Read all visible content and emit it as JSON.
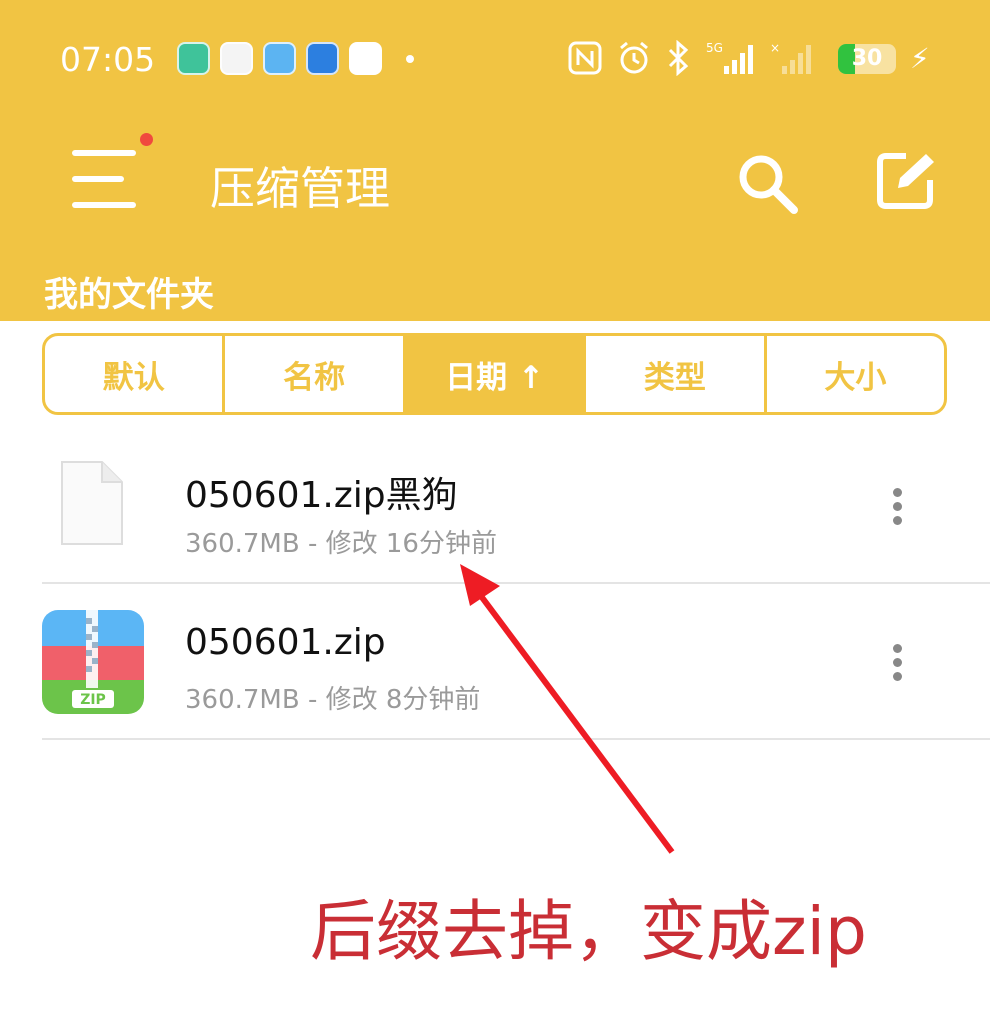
{
  "status_bar": {
    "time": "07:05",
    "battery": "30",
    "battery_level": 0.3,
    "icons": [
      "nfc-icon",
      "alarm-icon",
      "bluetooth-icon",
      "signal-5g-icon",
      "signal-icon",
      "battery-icon",
      "charging-icon"
    ]
  },
  "toolbar": {
    "title": "压缩管理",
    "has_notification": true
  },
  "folder": {
    "title": "我的文件夹"
  },
  "sort_tabs": [
    {
      "label": "默认",
      "active": false
    },
    {
      "label": "名称",
      "active": false
    },
    {
      "label": "日期 ↑",
      "active": true
    },
    {
      "label": "类型",
      "active": false
    },
    {
      "label": "大小",
      "active": false
    }
  ],
  "files": [
    {
      "name": "050601.zip黑狗",
      "meta": "360.7MB - 修改 16分钟前",
      "icon": "blank-file-icon"
    },
    {
      "name": "050601.zip",
      "meta": "360.7MB - 修改 8分钟前",
      "icon": "zip-file-icon"
    }
  ],
  "annotation": {
    "text": "后缀去掉，变成zip",
    "color": "#C92E35"
  },
  "colors": {
    "accent": "#F1C443",
    "notification": "#F04A3E"
  }
}
